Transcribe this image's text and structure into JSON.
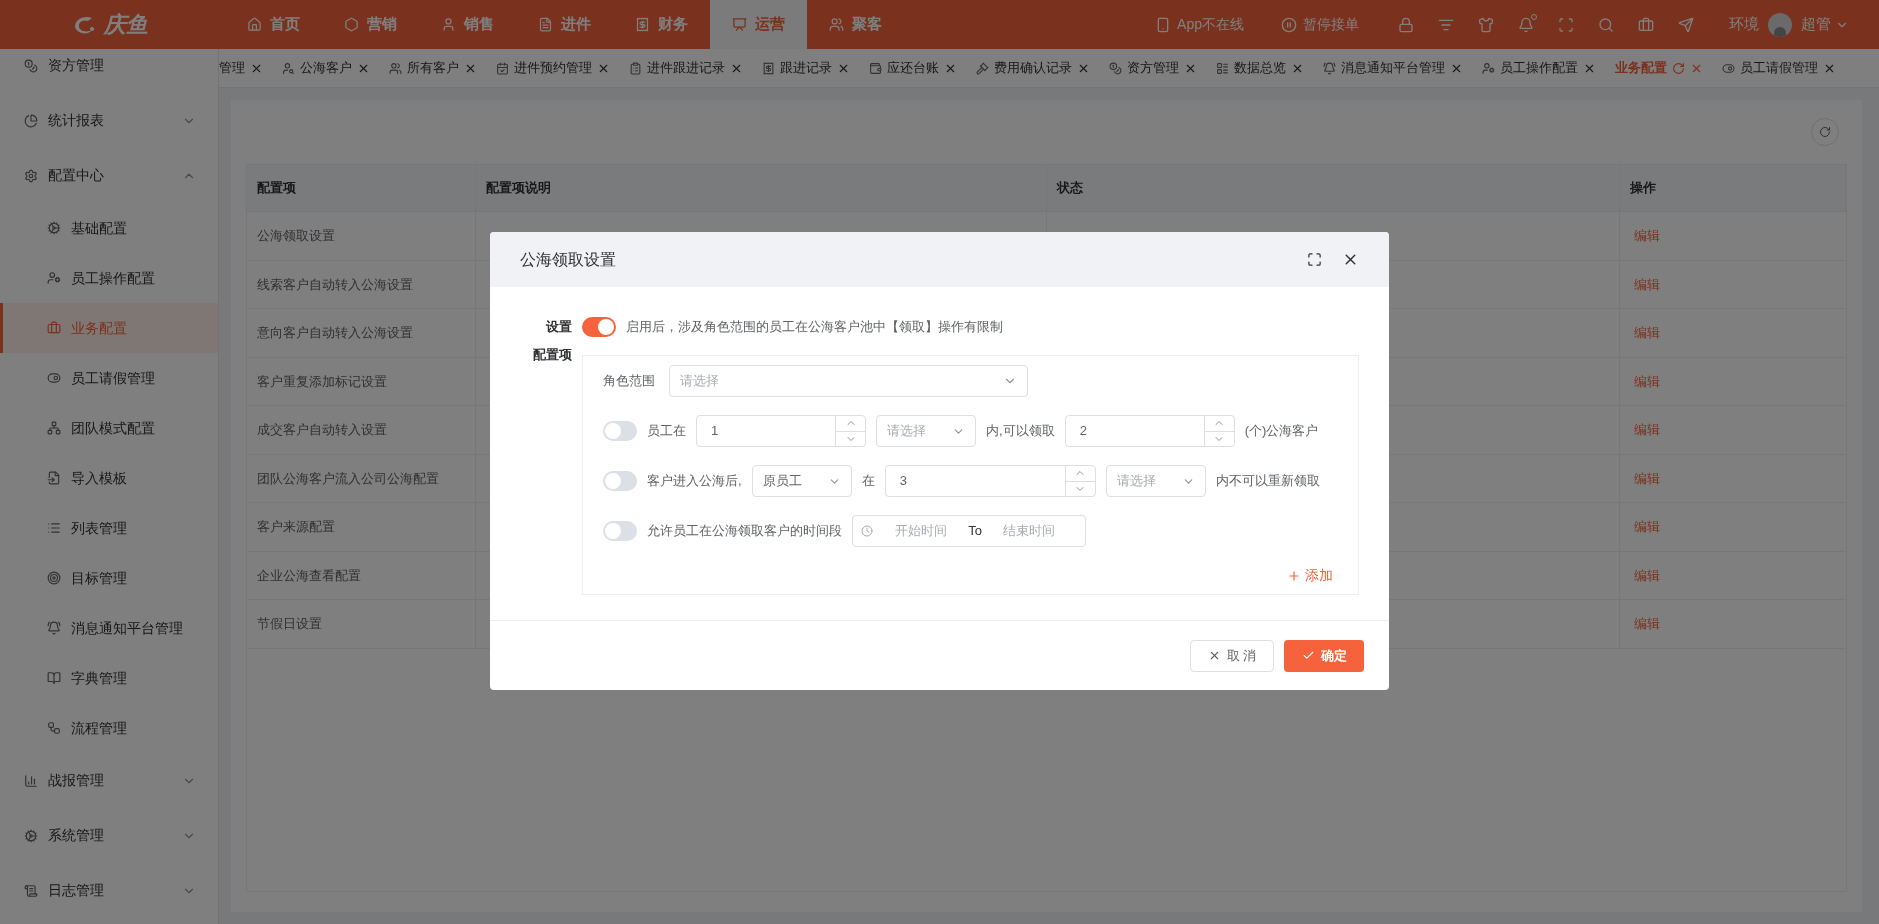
{
  "header": {
    "logo": "庆鱼",
    "nav": [
      {
        "label": "首页",
        "selected": false
      },
      {
        "label": "营销",
        "selected": false
      },
      {
        "label": "销售",
        "selected": false
      },
      {
        "label": "进件",
        "selected": false
      },
      {
        "label": "财务",
        "selected": false
      },
      {
        "label": "运营",
        "selected": true
      },
      {
        "label": "聚客",
        "selected": false
      }
    ],
    "app_status": "App不在线",
    "pause": "暂停接单",
    "environment": "环境",
    "user": "超管"
  },
  "tabs": [
    {
      "label": "管理",
      "selected": false
    },
    {
      "label": "公海客户",
      "selected": false
    },
    {
      "label": "所有客户",
      "selected": false
    },
    {
      "label": "进件预约管理",
      "selected": false
    },
    {
      "label": "进件跟进记录",
      "selected": false
    },
    {
      "label": "跟进记录",
      "selected": false
    },
    {
      "label": "应还台账",
      "selected": false
    },
    {
      "label": "费用确认记录",
      "selected": false
    },
    {
      "label": "资方管理",
      "selected": false
    },
    {
      "label": "数据总览",
      "selected": false
    },
    {
      "label": "消息通知平台管理",
      "selected": false
    },
    {
      "label": "员工操作配置",
      "selected": false
    },
    {
      "label": "业务配置",
      "selected": true
    },
    {
      "label": "员工请假管理",
      "selected": false
    }
  ],
  "sidebar": {
    "items": [
      {
        "kind": "link",
        "label": "资方管理",
        "selected": false
      },
      {
        "kind": "group",
        "label": "统计报表",
        "expanded": false
      },
      {
        "kind": "group",
        "label": "配置中心",
        "expanded": true,
        "children": [
          {
            "label": "基础配置",
            "selected": false
          },
          {
            "label": "员工操作配置",
            "selected": false
          },
          {
            "label": "业务配置",
            "selected": true
          },
          {
            "label": "员工请假管理",
            "selected": false
          },
          {
            "label": "团队模式配置",
            "selected": false
          },
          {
            "label": "导入模板",
            "selected": false
          },
          {
            "label": "列表管理",
            "selected": false
          },
          {
            "label": "目标管理",
            "selected": false
          },
          {
            "label": "消息通知平台管理",
            "selected": false
          },
          {
            "label": "字典管理",
            "selected": false
          },
          {
            "label": "流程管理",
            "selected": false
          }
        ]
      },
      {
        "kind": "group",
        "label": "战报管理",
        "expanded": false
      },
      {
        "kind": "group",
        "label": "系统管理",
        "expanded": false
      },
      {
        "kind": "group",
        "label": "日志管理",
        "expanded": false
      }
    ]
  },
  "table": {
    "columns": [
      "配置项",
      "配置项说明",
      "状态",
      "操作"
    ],
    "rows": [
      {
        "name": "公海领取设置",
        "action": "编辑"
      },
      {
        "name": "线索客户自动转入公海设置",
        "action": "编辑"
      },
      {
        "name": "意向客户自动转入公海设置",
        "action": "编辑"
      },
      {
        "name": "客户重复添加标记设置",
        "action": "编辑"
      },
      {
        "name": "成交客户自动转入设置",
        "action": "编辑"
      },
      {
        "name": "团队公海客户流入公司公海配置",
        "action": "编辑"
      },
      {
        "name": "客户来源配置",
        "action": "编辑"
      },
      {
        "name": "企业公海查看配置",
        "action": "编辑"
      },
      {
        "name": "节假日设置",
        "action": "编辑"
      }
    ]
  },
  "modal": {
    "title": "公海领取设置",
    "setting": {
      "label": "设置",
      "on": true,
      "hint": "启用后，涉及角色范围的员工在公海客户池中【领取】操作有限制"
    },
    "config_label": "配置项",
    "role_scope": {
      "label": "角色范围",
      "placeholder": "请选择"
    },
    "rules": [
      {
        "on": false,
        "parts": [
          {
            "kind": "text",
            "text": "员工在"
          },
          {
            "kind": "number",
            "value": "1"
          },
          {
            "kind": "select",
            "placeholder": "请选择"
          },
          {
            "kind": "text",
            "text": "内,可以领取"
          },
          {
            "kind": "number",
            "value": "2"
          },
          {
            "kind": "text",
            "text": "(个)公海客户"
          }
        ]
      },
      {
        "on": false,
        "parts": [
          {
            "kind": "text",
            "text": "客户进入公海后,"
          },
          {
            "kind": "select",
            "value": "原员工"
          },
          {
            "kind": "text",
            "text": "在"
          },
          {
            "kind": "number",
            "value": "3"
          },
          {
            "kind": "select",
            "placeholder": "请选择"
          },
          {
            "kind": "text",
            "text": "内不可以重新领取"
          }
        ]
      },
      {
        "on": false,
        "parts": [
          {
            "kind": "text",
            "text": "允许员工在公海领取客户的时间段"
          },
          {
            "kind": "timerange",
            "start_placeholder": "开始时间",
            "separator": "To",
            "end_placeholder": "结束时间"
          }
        ]
      }
    ],
    "add_button": "添加",
    "cancel_button": "取 消",
    "confirm_button": "确定"
  }
}
